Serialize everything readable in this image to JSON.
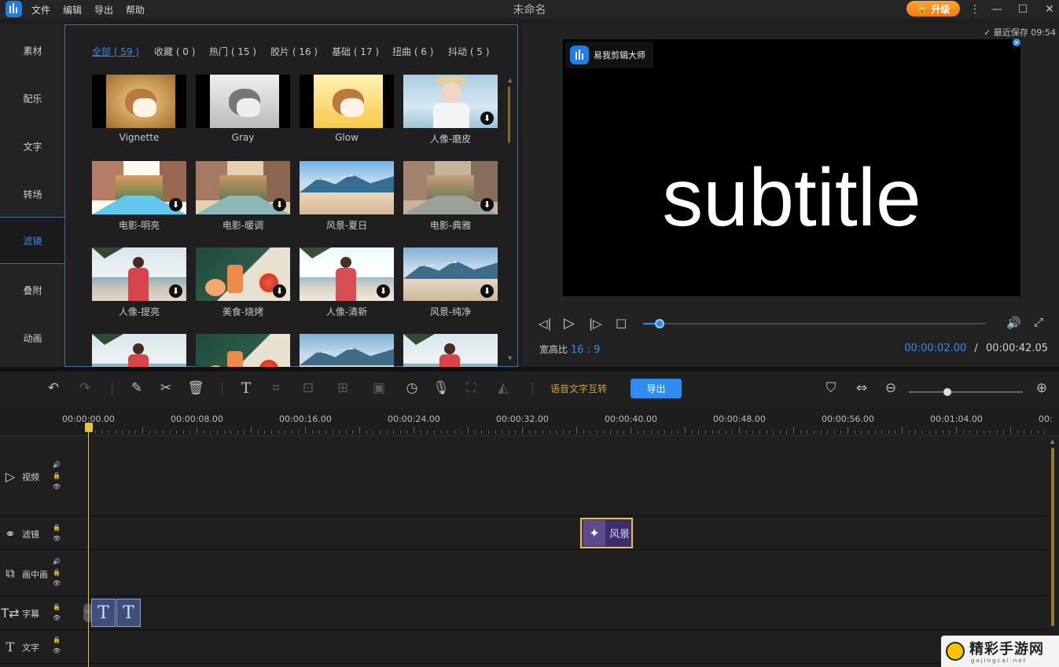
{
  "app": {
    "title": "未命名",
    "menu": [
      "文件",
      "编辑",
      "导出",
      "帮助"
    ],
    "upgrade_label": "升级"
  },
  "nav": {
    "items": [
      {
        "label": "素材",
        "active": false
      },
      {
        "label": "配乐",
        "active": false
      },
      {
        "label": "文字",
        "active": false
      },
      {
        "label": "转场",
        "active": false
      },
      {
        "label": "滤镜",
        "active": true
      },
      {
        "label": "叠附",
        "active": false
      },
      {
        "label": "动画",
        "active": false
      }
    ]
  },
  "library": {
    "categories": [
      {
        "label": "全部 ( 59 )",
        "active": true
      },
      {
        "label": "收藏 ( 0 )",
        "active": false
      },
      {
        "label": "热门 ( 15 )",
        "active": false
      },
      {
        "label": "胶片 ( 16 )",
        "active": false
      },
      {
        "label": "基础 ( 17 )",
        "active": false
      },
      {
        "label": "扭曲 ( 6 )",
        "active": false
      },
      {
        "label": "抖动 ( 5 )",
        "active": false
      }
    ],
    "filters": [
      {
        "label": "Vignette",
        "thumb": "cat",
        "tone": "vignette",
        "download": false
      },
      {
        "label": "Gray",
        "thumb": "cat",
        "tone": "gray",
        "download": false
      },
      {
        "label": "Glow",
        "thumb": "cat",
        "tone": "glow",
        "download": false
      },
      {
        "label": "人像-磨皮",
        "thumb": "portrait-hat",
        "tone": "normal",
        "download": true
      },
      {
        "label": "电影-明亮",
        "thumb": "street",
        "tone": "bright",
        "download": true
      },
      {
        "label": "电影-暖调",
        "thumb": "street",
        "tone": "warm",
        "download": true
      },
      {
        "label": "风景-夏日",
        "thumb": "mountain",
        "tone": "summer",
        "download": false
      },
      {
        "label": "电影-典雅",
        "thumb": "street",
        "tone": "elegant",
        "download": true
      },
      {
        "label": "人像-提亮",
        "thumb": "beach-girl",
        "tone": "normal",
        "download": true
      },
      {
        "label": "美食-烧烤",
        "thumb": "food",
        "tone": "normal",
        "download": true
      },
      {
        "label": "人像-清新",
        "thumb": "beach-girl",
        "tone": "fresh",
        "download": true
      },
      {
        "label": "风景-纯净",
        "thumb": "mountain",
        "tone": "pure",
        "download": true
      },
      {
        "label": "",
        "thumb": "beach-girl",
        "tone": "normal",
        "download": false
      },
      {
        "label": "",
        "thumb": "food",
        "tone": "normal",
        "download": false
      },
      {
        "label": "",
        "thumb": "mountain",
        "tone": "normal",
        "download": false
      },
      {
        "label": "",
        "thumb": "beach-girl",
        "tone": "normal",
        "download": false
      }
    ]
  },
  "preview": {
    "save_status": "最近保存 09:54",
    "watermark": "易我剪辑大师",
    "subtitle": "subtitle",
    "aspect_label": "宽高比",
    "aspect_value": "16 : 9",
    "current_time": "00:00:02.00",
    "time_sep": "/",
    "total_time": "00:00:42.05",
    "progress_fraction": 0.048
  },
  "toolbar": {
    "speech_to_text": "语音文字互转",
    "export_label": "导出",
    "zoom_fraction": 0.34
  },
  "timeline": {
    "ruler_labels": [
      "00:00:00.00",
      "00:00:08.00",
      "00:00:16.00",
      "00:00:24.00",
      "00:00:32.00",
      "00:00:40.00",
      "00:00:48.00",
      "00:00:56.00",
      "00:01:04.00",
      "00:"
    ],
    "tracks": [
      {
        "name": "视频",
        "icon": "video-track-icon"
      },
      {
        "name": "滤镜",
        "icon": "filter-track-icon"
      },
      {
        "name": "画中画",
        "icon": "pip-track-icon"
      },
      {
        "name": "字幕",
        "icon": "subtitle-track-icon"
      },
      {
        "name": "文字",
        "icon": "text-track-icon"
      }
    ],
    "filter_clip_label": "风景"
  },
  "brand": {
    "name": "精彩手游网",
    "url": "gojingcai.net"
  },
  "colors": {
    "accent": "#2f8df0",
    "upgrade": "#f58c18",
    "playhead": "#e8c43a",
    "filter_clip": "#3f2d6a"
  }
}
